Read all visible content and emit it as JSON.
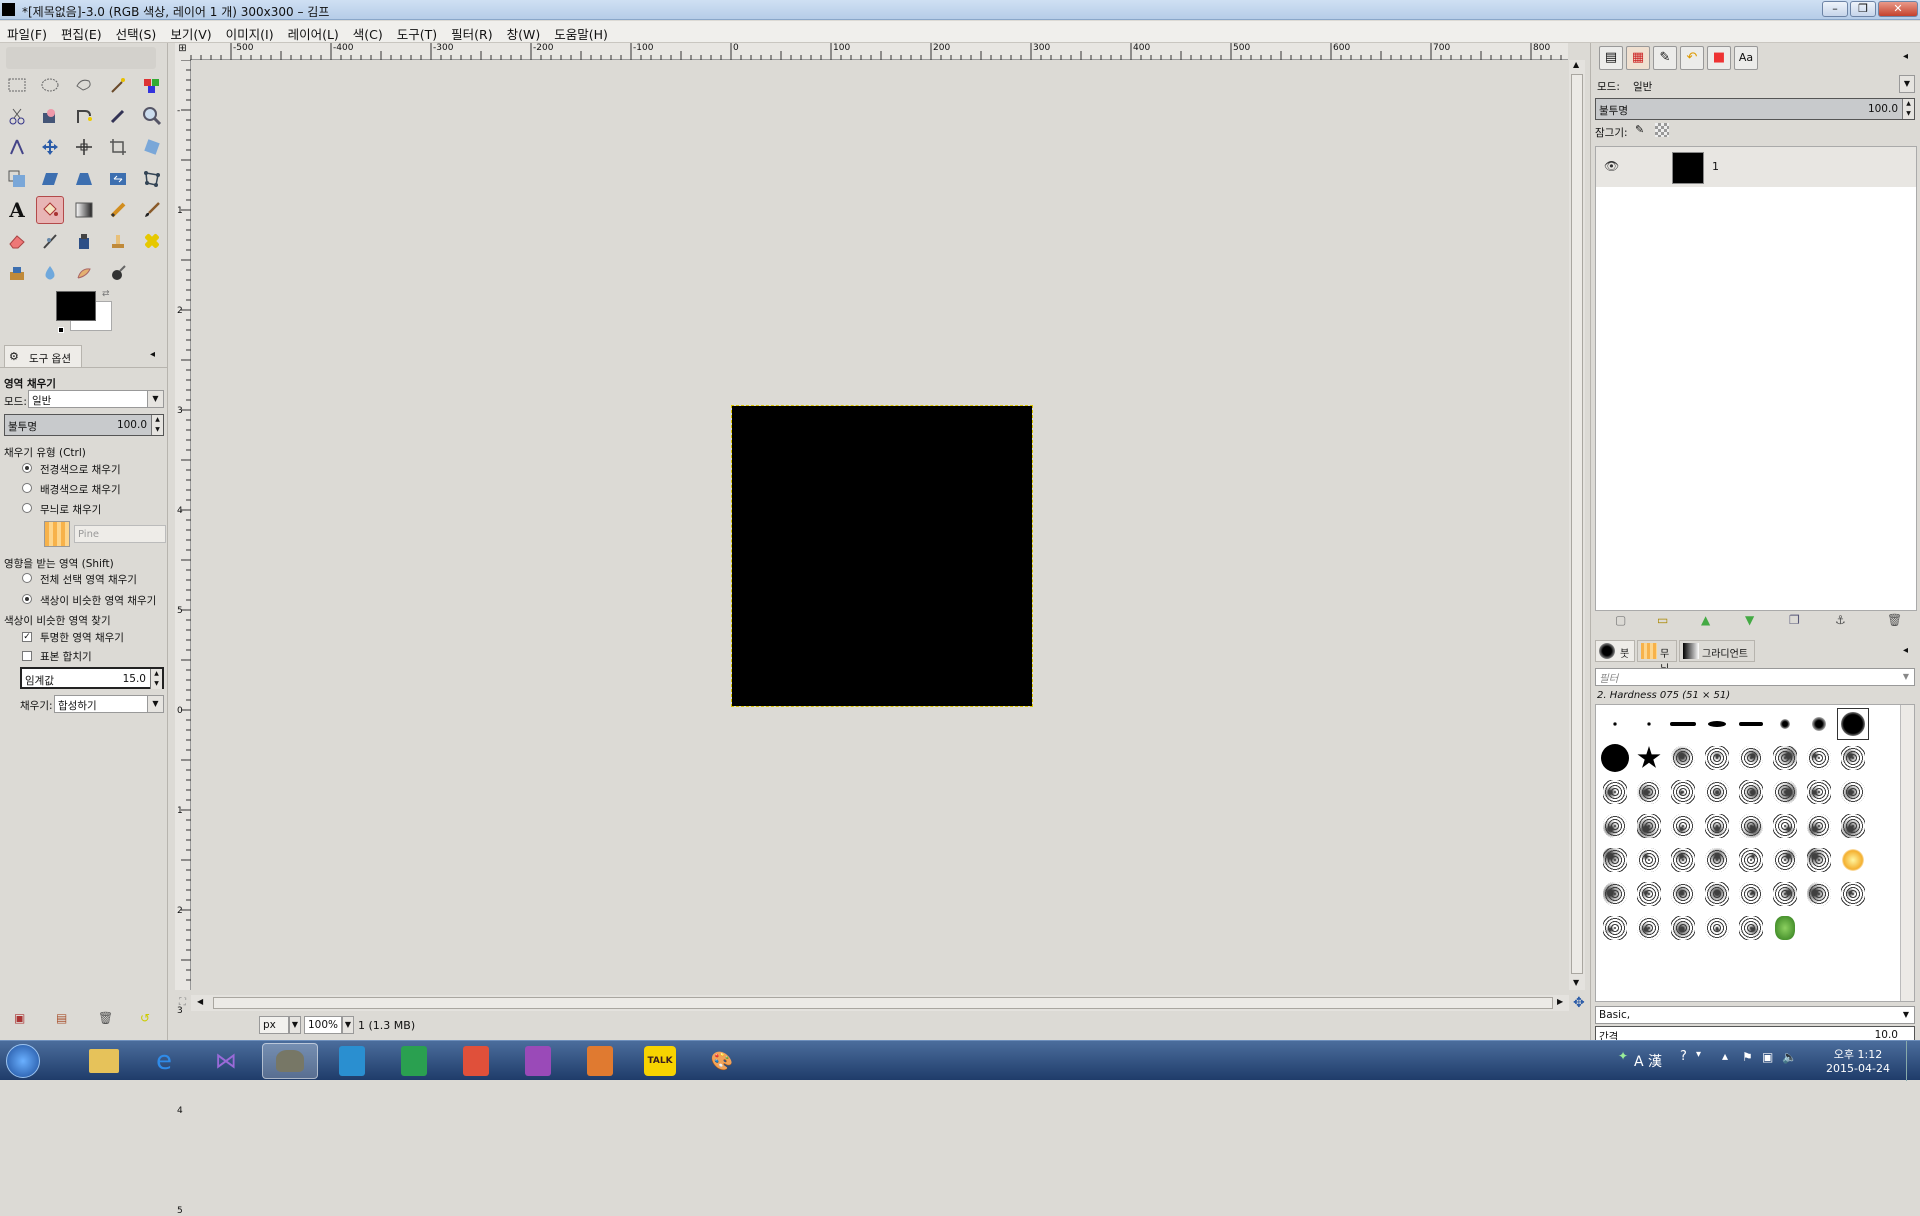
{
  "window": {
    "title": "*[제목없음]-3.0 (RGB 색상, 레이어 1 개) 300x300 – 김프",
    "controls": [
      "–",
      "❐",
      "✕"
    ]
  },
  "menu": [
    "파일(F)",
    "편집(E)",
    "선택(S)",
    "보기(V)",
    "이미지(I)",
    "레이어(L)",
    "색(C)",
    "도구(T)",
    "필터(R)",
    "창(W)",
    "도움말(H)"
  ],
  "tool_options": {
    "tab_label": "도구 옵션",
    "tool_name": "영역 채우기",
    "mode_label": "모드:",
    "mode_value": "일반",
    "opacity_label": "불투명",
    "opacity_value": "100.0",
    "fill_type_label": "채우기 유형 (Ctrl)",
    "fill_fg": "전경색으로 채우기",
    "fill_bg": "배경색으로 채우기",
    "fill_pattern": "무늬로 채우기",
    "pattern_name": "Pine",
    "affected_label": "영향을 받는 영역 (Shift)",
    "affected_all": "전체 선택 영역 채우기",
    "affected_similar": "색상이 비슷한 영역 채우기",
    "similar_label": "색상이 비슷한 영역 찾기",
    "fill_transparent": "투명한 영역 채우기",
    "sample_merged": "표본 합치기",
    "threshold_label": "임계값",
    "threshold_value": "15.0",
    "fill_by_label": "채우기:",
    "fill_by_value": "합성하기"
  },
  "rulers": {
    "h_ticks": [
      "-500",
      "-400",
      "-300",
      "-200",
      "-100",
      "0",
      "100",
      "200",
      "300",
      "400",
      "500",
      "600",
      "700",
      "800"
    ],
    "v_ticks": [
      "-",
      "1",
      "2",
      "3",
      "4",
      "5",
      "0",
      "1",
      "2",
      "3",
      "4",
      "5"
    ]
  },
  "status": {
    "unit": "px",
    "zoom": "100%",
    "info": "1 (1.3 MB)"
  },
  "layers": {
    "mode_label": "모드:",
    "mode_value": "일반",
    "opacity_label": "불투명",
    "opacity_value": "100.0",
    "lock_label": "잠그기:",
    "layer_name": "1"
  },
  "brushes": {
    "tab_brush": "붓",
    "tab_pattern": "무늬",
    "tab_gradient": "그라디언트",
    "filter_placeholder": "필터",
    "current_brush": "2. Hardness 075 (51 × 51)",
    "preset": "Basic,",
    "spacing_label": "간격",
    "spacing_value": "10.0"
  },
  "taskbar": {
    "time": "오후 1:12",
    "date": "2015-04-24",
    "ime": "A 漢"
  },
  "colors": {
    "foreground": "#000000",
    "background": "#ffffff",
    "image_fill": "#000000",
    "selection": "#d8c200"
  }
}
